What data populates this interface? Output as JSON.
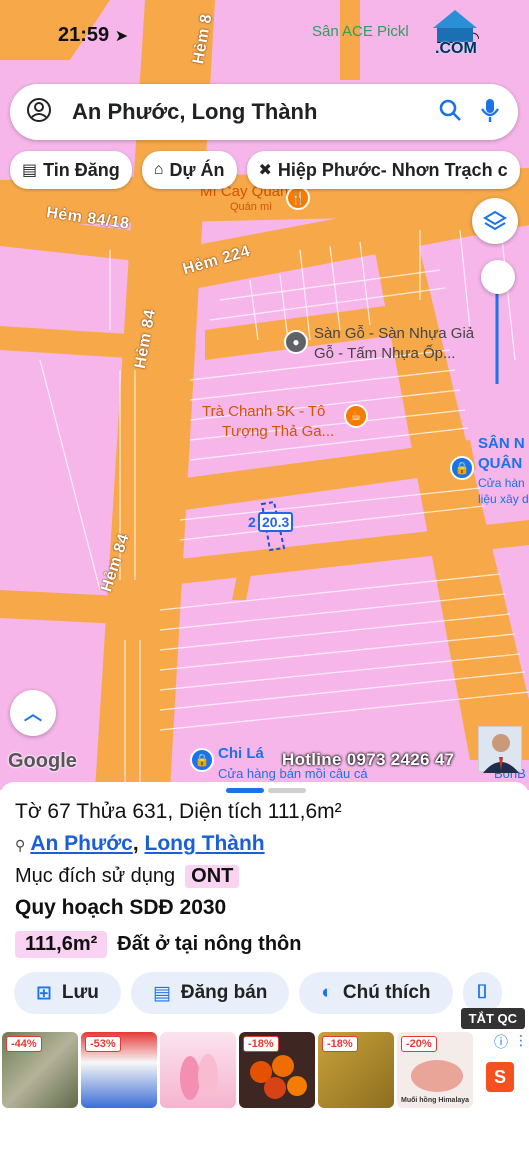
{
  "status_bar": {
    "time": "21:59"
  },
  "corner_logo": {
    "text": "Sân ACE Pickl",
    "com": ".COM"
  },
  "search": {
    "query": "An Phước, Long Thành"
  },
  "chips": [
    {
      "icon": "list-icon",
      "label": "Tin Đăng"
    },
    {
      "icon": "building-icon",
      "label": "Dự Án"
    },
    {
      "icon": "tools-icon",
      "label": "Hiệp Phước- Nhơn Trạch c"
    }
  ],
  "map": {
    "roads": {
      "hem_84_18": "Hẻm 84/18",
      "hem_224": "Hẻm 224",
      "hem_84_a": "Hẻm 84",
      "hem_84_b": "Hẻm 84",
      "hem_8": "Hẻm 8"
    },
    "pois": {
      "mi_cay": "Mì Cay Quán",
      "mi_cay_sub": "Quán mì",
      "san_go_1": "Sàn Gỗ - Sàn Nhựa Giả",
      "san_go_2": "Gỗ - Tấm Nhựa Ốp...",
      "tra_chanh_1": "Trà Chanh 5K - Tô",
      "tra_chanh_2": "Tượng Thả Ga...",
      "san_n_1": "SÂN N",
      "san_n_2": "QUÂN",
      "san_n_3": "Cửa hàn",
      "san_n_4": "liệu xây d",
      "chi_la": "Chi Lá",
      "chi_la_sub": "Cửa hàng bán mồi câu cá",
      "bon": "BonB"
    },
    "plot_label": "20.3",
    "plot_label_prefix": "2",
    "google": "Google",
    "hotline": "Hotline 0973 2426 47"
  },
  "sheet": {
    "title": "Tờ 67 Thửa 631, Diện tích 111,6m²",
    "location_a": "An Phước",
    "location_sep": ",",
    "location_b": "Long Thành",
    "purpose_label": "Mục đích sử dụng",
    "purpose_code": "ONT",
    "plan_title": "Quy hoạch SDĐ 2030",
    "area": "111,6m²",
    "area_desc": "Đất ở tại nông thôn",
    "actions": [
      {
        "icon": "bookmark-plus-icon",
        "label": "Lưu"
      },
      {
        "icon": "listing-icon",
        "label": "Đăng bán"
      },
      {
        "icon": "contrast-icon",
        "label": "Chú thích"
      },
      {
        "icon": "camera-icon",
        "label": ""
      }
    ]
  },
  "ads": {
    "tat_qc": "TẮT QC",
    "items": [
      {
        "discount": "-44%"
      },
      {
        "discount": "-53%"
      },
      {
        "discount": ""
      },
      {
        "discount": "-18%"
      },
      {
        "discount": "-18%"
      },
      {
        "discount": "-20%"
      }
    ],
    "himalaya": "Muối hồng Himalaya"
  },
  "colors": {
    "road": "#f7a94a",
    "land": "#f6b6ea",
    "accent": "#1a73e8",
    "badge": "#fad3f2"
  }
}
